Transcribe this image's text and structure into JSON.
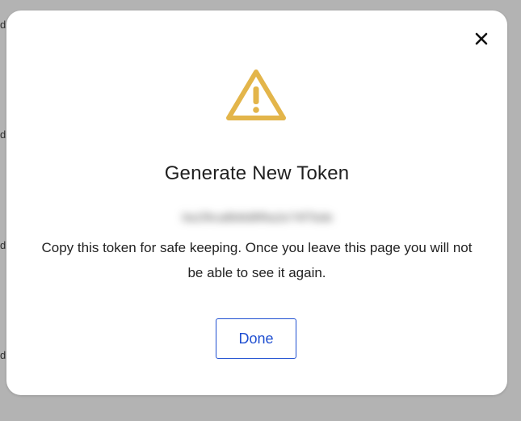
{
  "background": {
    "row_edges": [
      "d",
      "d",
      "d",
      "d"
    ]
  },
  "modal": {
    "close_icon": "close-icon",
    "warning_icon": "warning-triangle-icon",
    "title": "Generate New Token",
    "token_value": "0a1f9ca8b8d8f6a2e74f7bde",
    "message": "Copy this token for safe keeping. Once you leave this page you will not be able to see it again.",
    "done_label": "Done",
    "colors": {
      "warning": "#e3b54a",
      "primary": "#1f4fd1",
      "text": "#222222",
      "backdrop": "#b3b3b3"
    }
  }
}
